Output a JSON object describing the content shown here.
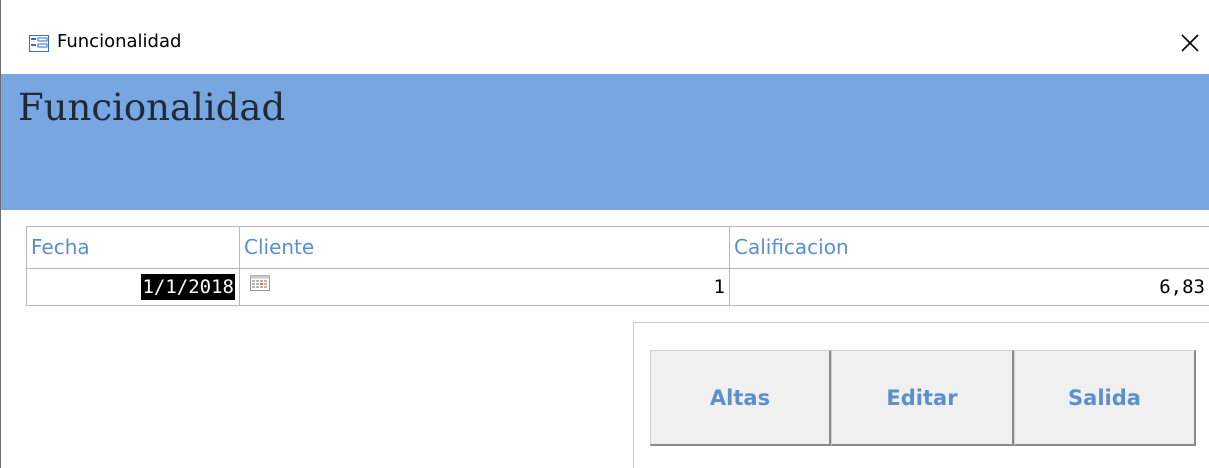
{
  "window": {
    "title": "Funcionalidad",
    "icon": "form-icon",
    "close_icon": "close-icon"
  },
  "header": {
    "title": "Funcionalidad",
    "background_color": "#78a6e1"
  },
  "grid": {
    "columns": [
      "Fecha",
      "Cliente",
      "Calificacion"
    ],
    "rows": [
      {
        "fecha": "1/1/2018",
        "cliente": "1",
        "calificacion": "6,83"
      }
    ],
    "header_text_color": "#5b8fd0"
  },
  "buttons": {
    "altas": "Altas",
    "editar": "Editar",
    "salida": "Salida"
  }
}
